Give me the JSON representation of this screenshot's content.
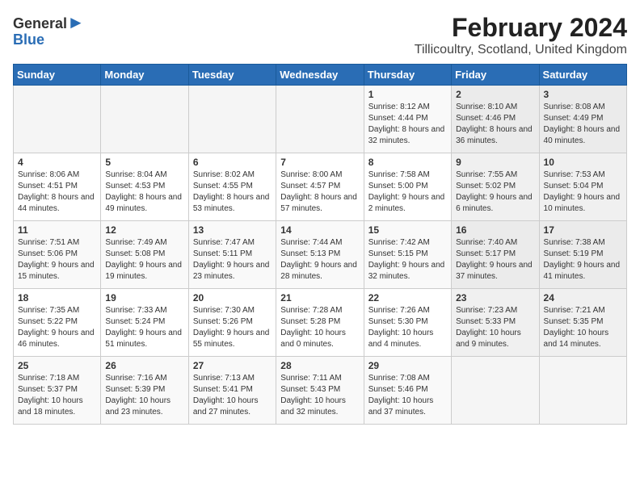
{
  "logo": {
    "line1": "General",
    "line2": "Blue"
  },
  "title": "February 2024",
  "subtitle": "Tillicoultry, Scotland, United Kingdom",
  "days_of_week": [
    "Sunday",
    "Monday",
    "Tuesday",
    "Wednesday",
    "Thursday",
    "Friday",
    "Saturday"
  ],
  "weeks": [
    [
      {
        "day": "",
        "info": ""
      },
      {
        "day": "",
        "info": ""
      },
      {
        "day": "",
        "info": ""
      },
      {
        "day": "",
        "info": ""
      },
      {
        "day": "1",
        "info": "Sunrise: 8:12 AM\nSunset: 4:44 PM\nDaylight: 8 hours and 32 minutes."
      },
      {
        "day": "2",
        "info": "Sunrise: 8:10 AM\nSunset: 4:46 PM\nDaylight: 8 hours and 36 minutes."
      },
      {
        "day": "3",
        "info": "Sunrise: 8:08 AM\nSunset: 4:49 PM\nDaylight: 8 hours and 40 minutes."
      }
    ],
    [
      {
        "day": "4",
        "info": "Sunrise: 8:06 AM\nSunset: 4:51 PM\nDaylight: 8 hours and 44 minutes."
      },
      {
        "day": "5",
        "info": "Sunrise: 8:04 AM\nSunset: 4:53 PM\nDaylight: 8 hours and 49 minutes."
      },
      {
        "day": "6",
        "info": "Sunrise: 8:02 AM\nSunset: 4:55 PM\nDaylight: 8 hours and 53 minutes."
      },
      {
        "day": "7",
        "info": "Sunrise: 8:00 AM\nSunset: 4:57 PM\nDaylight: 8 hours and 57 minutes."
      },
      {
        "day": "8",
        "info": "Sunrise: 7:58 AM\nSunset: 5:00 PM\nDaylight: 9 hours and 2 minutes."
      },
      {
        "day": "9",
        "info": "Sunrise: 7:55 AM\nSunset: 5:02 PM\nDaylight: 9 hours and 6 minutes."
      },
      {
        "day": "10",
        "info": "Sunrise: 7:53 AM\nSunset: 5:04 PM\nDaylight: 9 hours and 10 minutes."
      }
    ],
    [
      {
        "day": "11",
        "info": "Sunrise: 7:51 AM\nSunset: 5:06 PM\nDaylight: 9 hours and 15 minutes."
      },
      {
        "day": "12",
        "info": "Sunrise: 7:49 AM\nSunset: 5:08 PM\nDaylight: 9 hours and 19 minutes."
      },
      {
        "day": "13",
        "info": "Sunrise: 7:47 AM\nSunset: 5:11 PM\nDaylight: 9 hours and 23 minutes."
      },
      {
        "day": "14",
        "info": "Sunrise: 7:44 AM\nSunset: 5:13 PM\nDaylight: 9 hours and 28 minutes."
      },
      {
        "day": "15",
        "info": "Sunrise: 7:42 AM\nSunset: 5:15 PM\nDaylight: 9 hours and 32 minutes."
      },
      {
        "day": "16",
        "info": "Sunrise: 7:40 AM\nSunset: 5:17 PM\nDaylight: 9 hours and 37 minutes."
      },
      {
        "day": "17",
        "info": "Sunrise: 7:38 AM\nSunset: 5:19 PM\nDaylight: 9 hours and 41 minutes."
      }
    ],
    [
      {
        "day": "18",
        "info": "Sunrise: 7:35 AM\nSunset: 5:22 PM\nDaylight: 9 hours and 46 minutes."
      },
      {
        "day": "19",
        "info": "Sunrise: 7:33 AM\nSunset: 5:24 PM\nDaylight: 9 hours and 51 minutes."
      },
      {
        "day": "20",
        "info": "Sunrise: 7:30 AM\nSunset: 5:26 PM\nDaylight: 9 hours and 55 minutes."
      },
      {
        "day": "21",
        "info": "Sunrise: 7:28 AM\nSunset: 5:28 PM\nDaylight: 10 hours and 0 minutes."
      },
      {
        "day": "22",
        "info": "Sunrise: 7:26 AM\nSunset: 5:30 PM\nDaylight: 10 hours and 4 minutes."
      },
      {
        "day": "23",
        "info": "Sunrise: 7:23 AM\nSunset: 5:33 PM\nDaylight: 10 hours and 9 minutes."
      },
      {
        "day": "24",
        "info": "Sunrise: 7:21 AM\nSunset: 5:35 PM\nDaylight: 10 hours and 14 minutes."
      }
    ],
    [
      {
        "day": "25",
        "info": "Sunrise: 7:18 AM\nSunset: 5:37 PM\nDaylight: 10 hours and 18 minutes."
      },
      {
        "day": "26",
        "info": "Sunrise: 7:16 AM\nSunset: 5:39 PM\nDaylight: 10 hours and 23 minutes."
      },
      {
        "day": "27",
        "info": "Sunrise: 7:13 AM\nSunset: 5:41 PM\nDaylight: 10 hours and 27 minutes."
      },
      {
        "day": "28",
        "info": "Sunrise: 7:11 AM\nSunset: 5:43 PM\nDaylight: 10 hours and 32 minutes."
      },
      {
        "day": "29",
        "info": "Sunrise: 7:08 AM\nSunset: 5:46 PM\nDaylight: 10 hours and 37 minutes."
      },
      {
        "day": "",
        "info": ""
      },
      {
        "day": "",
        "info": ""
      }
    ]
  ]
}
